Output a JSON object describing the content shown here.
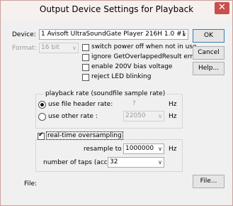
{
  "window": {
    "title": "Output Device Settings for Playback",
    "close_glyph": "✕"
  },
  "device": {
    "label": "Device:",
    "value": "1 Avisoft UltraSoundGate Player 216H 1.0 #1"
  },
  "format": {
    "label": "Format:",
    "value": "16 bit"
  },
  "options": {
    "switch_power_off": {
      "label": "switch power off when not in use",
      "checked": false
    },
    "ignore_overlapped": {
      "label": "ignore GetOverlappedResult error",
      "checked": false
    },
    "enable_200v": {
      "label": "enable 200V bias voltage",
      "checked": false
    },
    "reject_led": {
      "label": "reject LED blinking",
      "checked": false
    }
  },
  "buttons": {
    "ok": "OK",
    "cancel": "Cancel",
    "help": "Help...",
    "file": "File..."
  },
  "playback_rate": {
    "group_label": "playback rate (soundfile sample rate)",
    "use_file_header": {
      "label": "use file header rate:",
      "selected": true,
      "value": "?",
      "unit": "Hz"
    },
    "use_other": {
      "label": "use other rate :",
      "selected": false,
      "value": "22050",
      "unit": "Hz"
    }
  },
  "oversampling": {
    "label": "real-time oversampling",
    "checked": true,
    "resample_to": {
      "label": "resample to :",
      "value": "1000000",
      "unit": "Hz"
    },
    "taps": {
      "label": "number of taps (accuracy) :",
      "value": "32"
    }
  },
  "file": {
    "label": "File:"
  }
}
